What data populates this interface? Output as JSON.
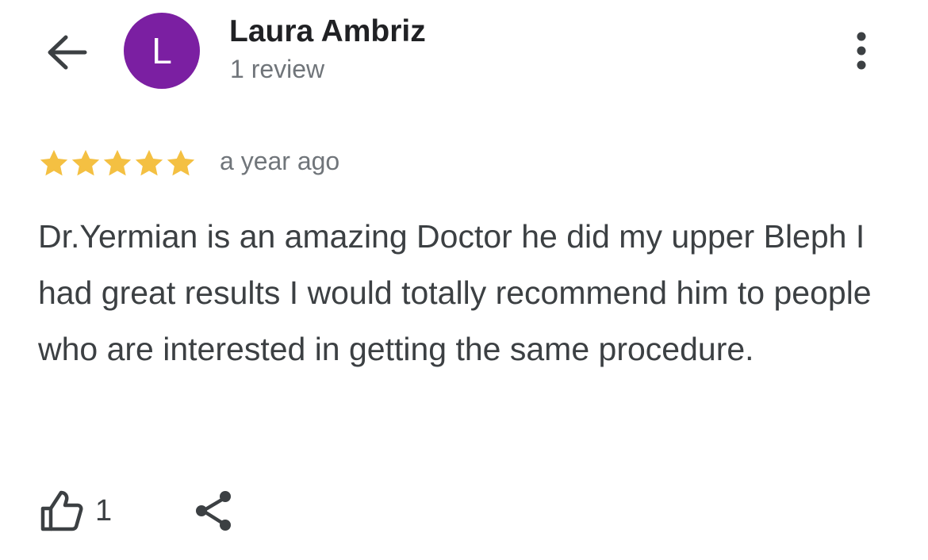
{
  "header": {
    "back_icon": "arrow-back-icon",
    "avatar": {
      "initial": "L",
      "color": "#7b1fa2"
    },
    "reviewer_name": "Laura Ambriz",
    "review_count": "1 review",
    "more_icon": "more-vertical-icon"
  },
  "review": {
    "rating": 5,
    "max_rating": 5,
    "star_color": "#f4c042",
    "time": "a year ago",
    "text": "Dr.Yermian is an amazing Doctor he did my upper Bleph I had great results I would totally recommend him to people who are interested in getting the same procedure."
  },
  "actions": {
    "like_icon": "thumbs-up-icon",
    "like_count": "1",
    "share_icon": "share-icon"
  }
}
